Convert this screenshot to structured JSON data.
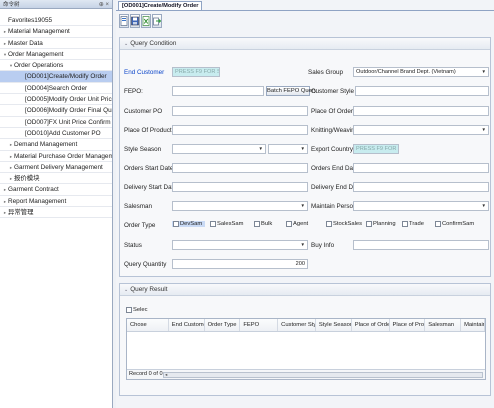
{
  "sidebar": {
    "header": "命令树",
    "pin": "⊕ ×",
    "items": [
      {
        "label": "Favorites19055",
        "level": 0,
        "arrow": ""
      },
      {
        "label": "Material Management",
        "level": 0,
        "arrow": "▸"
      },
      {
        "label": "Master Data",
        "level": 0,
        "arrow": "▸"
      },
      {
        "label": "Order Management",
        "level": 0,
        "arrow": "▾"
      },
      {
        "label": "Order Operations",
        "level": 1,
        "arrow": "▾"
      },
      {
        "label": "[OD001]Create/Modify Order",
        "level": 2,
        "arrow": "",
        "selected": true
      },
      {
        "label": "[OD004]Search Order",
        "level": 2,
        "arrow": ""
      },
      {
        "label": "[OD005]Modify Order Unit Price",
        "level": 2,
        "arrow": ""
      },
      {
        "label": "[OD006]Modify Order Final Quantity",
        "level": 2,
        "arrow": ""
      },
      {
        "label": "[OD007]FX Unit Price Confirm",
        "level": 2,
        "arrow": ""
      },
      {
        "label": "[OD010]Add Customer PO",
        "level": 2,
        "arrow": ""
      },
      {
        "label": "Demand Management",
        "level": 1,
        "arrow": "▸"
      },
      {
        "label": "Material Purchase Order Management",
        "level": 1,
        "arrow": "▸"
      },
      {
        "label": "Garment Delivery Management",
        "level": 1,
        "arrow": "▸"
      },
      {
        "label": "报价模块",
        "level": 1,
        "arrow": "▸"
      },
      {
        "label": "Garment Contract",
        "level": 0,
        "arrow": "▸"
      },
      {
        "label": "Report Management",
        "level": 0,
        "arrow": "▸"
      },
      {
        "label": "异常管理",
        "level": 0,
        "arrow": "▸"
      }
    ]
  },
  "tab": {
    "label": "[OD001]Create/Modify Order"
  },
  "toolbar": {
    "icons": [
      "new-icon",
      "save-icon",
      "excel-icon",
      "export-icon"
    ]
  },
  "query": {
    "title": "Query Condition",
    "end_customer_label": "End Customer",
    "end_customer_placeholder": "PRESS F9 FOR SE",
    "sales_group_label": "Sales Group",
    "sales_group_value": "Outdoor/Channel Brand Dept. (Vietnam)",
    "fepo_label": "FEPO:",
    "batch_fepo_button": "Batch FEPO Query",
    "customer_style_label": "Customer Style NO",
    "customer_po_label": "Customer PO",
    "place_of_orders_label": "Place Of Orders",
    "place_of_production_label": "Place Of Production",
    "knitting_label": "Knitting/Weaving",
    "style_season_label": "Style Season",
    "export_country_label": "Export Country",
    "export_country_placeholder": "PRESS F9 FOR SE",
    "orders_start_label": "Orders Start Date",
    "orders_end_label": "Orders End Date",
    "delivery_start_label": "Delivery Start Date",
    "delivery_end_label": "Delivery End Date",
    "salesman_label": "Salesman",
    "maintain_person_label": "Maintain Person",
    "order_type_label": "Order Type",
    "order_types": [
      "DevSam",
      "SalesSam",
      "Bulk",
      "Agent",
      "StockSales",
      "Planning",
      "Trade",
      "ConfirmSam"
    ],
    "status_label": "Status",
    "buy_info_label": "Buy Info",
    "query_quantity_label": "Query Quantity",
    "query_quantity_value": "200"
  },
  "result": {
    "title": "Query Result",
    "select_label": "Selec",
    "columns": [
      "Chose",
      "End Customer",
      "Order Type",
      "FEPO",
      "Customer Sty...",
      "Style Season",
      "Place of Order",
      "Place of Prod...",
      "Salesman",
      "Maintain ..."
    ],
    "record_text": "Record 0 of 0"
  }
}
